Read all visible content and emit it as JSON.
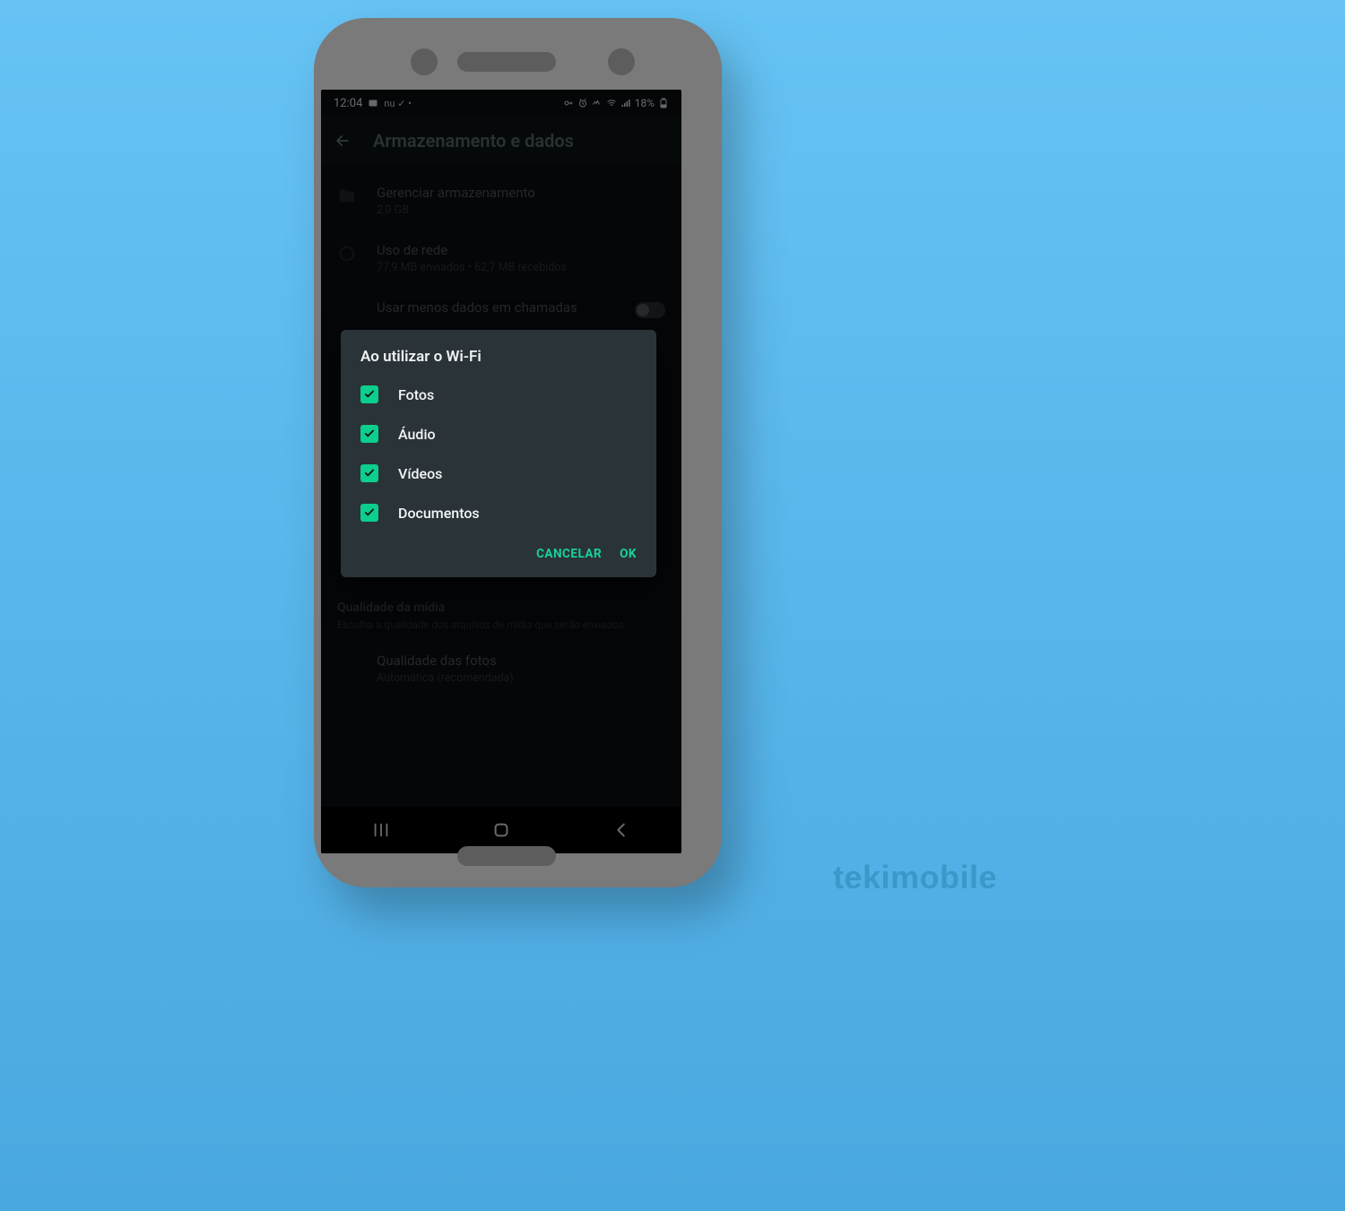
{
  "watermark": "tekimobile",
  "statusbar": {
    "time": "12:04",
    "battery": "18%",
    "indicators": "nu ✓ •"
  },
  "appbar": {
    "title": "Armazenamento e dados"
  },
  "settings": {
    "manage_storage": {
      "label": "Gerenciar armazenamento",
      "sub": "2,0 GB"
    },
    "network_usage": {
      "label": "Uso de rede",
      "sub": "77,9 MB enviados • 62,7 MB recebidos"
    },
    "less_data_calls": {
      "label": "Usar menos dados em chamadas"
    },
    "media_quality": {
      "header": "Qualidade da mídia",
      "desc": "Escolha a qualidade dos arquivos de mídia que serão enviados.",
      "photo_quality": {
        "label": "Qualidade das fotos",
        "sub": "Automática (recomendada)"
      }
    }
  },
  "dialog": {
    "title": "Ao utilizar o Wi-Fi",
    "options": {
      "photos": "Fotos",
      "audio": "Áudio",
      "videos": "Vídeos",
      "documents": "Documentos"
    },
    "cancel": "CANCELAR",
    "ok": "OK"
  }
}
